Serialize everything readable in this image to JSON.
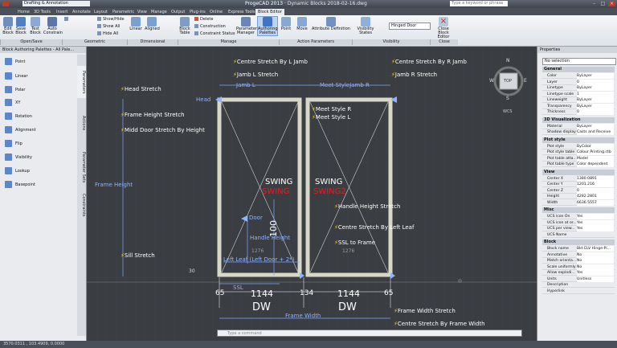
{
  "app": {
    "title": "Dynamic Blocks 2018-02-16.dwg",
    "workspace": "Drafting & Annotation",
    "search_placeholder": "Type a keyword or phrase"
  },
  "tabs": [
    "Home",
    "3D Tools",
    "Insert",
    "Annotate",
    "Layout",
    "Parametric",
    "View",
    "Manage",
    "Output",
    "Plug-ins",
    "Online",
    "Express Tools",
    "Block Editor"
  ],
  "ribbon": {
    "open_save": {
      "edit_block": "Edit Block",
      "save_block": "Save Block",
      "test_block": "Test Block",
      "auto_constrain": "Auto Constrain",
      "panel": "Open/Save"
    },
    "geometric": {
      "show_hide": "Show/Hide",
      "show_all": "Show All",
      "hide_all": "Hide All",
      "panel": "Geometric"
    },
    "dimensional": {
      "linear": "Linear",
      "aligned": "Aligned",
      "panel": "Dimensional"
    },
    "manage": {
      "block_table": "Block Table",
      "delete": "Delete",
      "construction": "Construction",
      "constraint_status": "Constraint Status",
      "panel": "Manage"
    },
    "parameters_manager": "Parameters Manager",
    "authoring_palettes": "Authoring Palettes",
    "action_parameters": {
      "point": "Point",
      "move": "Move",
      "attribute_definition": "Attribute Definition",
      "panel": "Action Parameters"
    },
    "visibility": {
      "visibility_states": "Visibility States",
      "state": "Hinged Door",
      "panel": "Visibility"
    },
    "close": {
      "close_block_editor": "Close Block Editor",
      "panel": "Close"
    }
  },
  "palette": {
    "title": "Block Authoring Palettes - All Pale...",
    "items": [
      "Point",
      "Linear",
      "Polar",
      "XY",
      "Rotation",
      "Alignment",
      "Flip",
      "Visibility",
      "Lookup",
      "Basepoint"
    ],
    "side_tabs": [
      "Parameters",
      "Actions",
      "Parameter Sets",
      "Constraints"
    ]
  },
  "drawing": {
    "labels_white": [
      "Centre Stretch By L Jamb",
      "Jamb L Stretch",
      "Centre Stretch By R Jamb",
      "Jamb R Stretch",
      "Head Stretch",
      "Frame Height Stretch",
      "Midd Door Stretch By Height",
      "Meet Style R",
      "Meet Style L",
      "Handle Height Stretch",
      "Centre Stretch By Left Leaf",
      "SSL to Frame",
      "Sill Stretch",
      "Frame Width Stretch",
      "Centre Stretch By Frame Width"
    ],
    "labels_blue": [
      "Jamb L",
      "Meet StyleJamb R",
      "Head",
      "Frame Height",
      "Door",
      "Handle Height",
      "Left Leaf (Left Door + 2*)",
      "SSL",
      "Frame Width"
    ],
    "swing_top": [
      "SWING",
      "SWING"
    ],
    "swing_red": [
      "SWING",
      "SWING2"
    ],
    "dims": {
      "d100": "100",
      "w1276a": "1276",
      "w1276b": "1276",
      "v30": "30",
      "b65a": "65",
      "b1144a": "1144",
      "b134": "134",
      "b1144b": "1144",
      "b65b": "65"
    },
    "dw": [
      "DW",
      "DW"
    ],
    "compass": {
      "n": "N",
      "s": "S",
      "e": "E",
      "w": "W",
      "top": "TOP",
      "wcs": "WCS"
    }
  },
  "properties": {
    "title": "Properties",
    "selection": "No selection",
    "sections": [
      {
        "name": "General",
        "rows": [
          [
            "Color",
            "ByLayer"
          ],
          [
            "Layer",
            "0"
          ],
          [
            "Linetype",
            "ByLayer"
          ],
          [
            "Linetype scale",
            "1"
          ],
          [
            "Lineweight",
            "ByLayer"
          ],
          [
            "Transparency",
            "ByLayer"
          ],
          [
            "Thickness",
            "0"
          ]
        ]
      },
      {
        "name": "3D Visualization",
        "rows": [
          [
            "Material",
            "ByLayer"
          ],
          [
            "Shadow display",
            "Casts and Receive"
          ]
        ]
      },
      {
        "name": "Plot style",
        "rows": [
          [
            "Plot style",
            "ByColor"
          ],
          [
            "Plot style table",
            "Colour Printing.ctb"
          ],
          [
            "Plot table atta...",
            "Model"
          ],
          [
            "Plot table type",
            "Color dependent"
          ]
        ]
      },
      {
        "name": "View",
        "rows": [
          [
            "Center X",
            "1380.0891"
          ],
          [
            "Center Y",
            "1201.216"
          ],
          [
            "Center Z",
            "0"
          ],
          [
            "Height",
            "4282.2801"
          ],
          [
            "Width",
            "6636.5557"
          ]
        ]
      },
      {
        "name": "Misc",
        "rows": [
          [
            "UCS icon On",
            "Yes"
          ],
          [
            "UCS icon at or...",
            "Yes"
          ],
          [
            "UCS per view...",
            "Yes"
          ],
          [
            "UCS Name",
            ""
          ]
        ]
      },
      {
        "name": "Block",
        "rows": [
          [
            "Block name",
            "Bkt ELV Hinge-Pi..."
          ],
          [
            "Annotative",
            "No"
          ],
          [
            "Match orienta...",
            "No"
          ],
          [
            "Scale uniformly",
            "No"
          ],
          [
            "Allow explodi...",
            "Yes"
          ],
          [
            "Units",
            "Unitless"
          ],
          [
            "Description",
            ""
          ],
          [
            "Hyperlink",
            ""
          ]
        ]
      }
    ]
  },
  "command": {
    "placeholder": "Type a command"
  },
  "status": {
    "coords": "3570.0311 , 103.4909, 0.0000"
  }
}
